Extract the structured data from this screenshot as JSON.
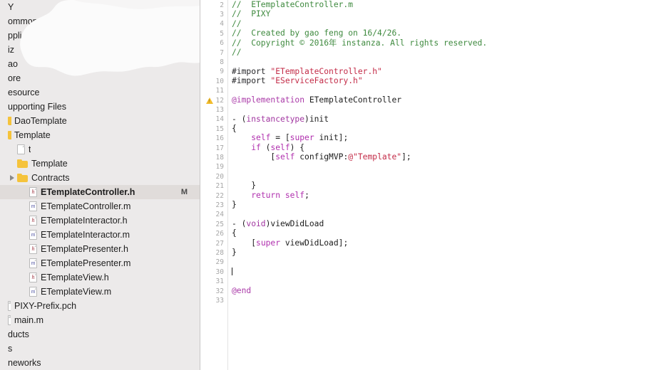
{
  "window": {
    "app": "Xcode",
    "accent": "#f5c33b",
    "selection_bg": "#e0dcda",
    "sidebar_bg": "#eceaea",
    "editor_bg": "#ffffff"
  },
  "sidebar": {
    "name": "project-navigator",
    "scrolled_horizontally": true,
    "items": [
      {
        "label": "Y",
        "depth": 0,
        "icon": "none",
        "tri": "none",
        "badge": "",
        "selected": false
      },
      {
        "label": "ommon",
        "depth": 0,
        "icon": "none",
        "tri": "none",
        "badge": "",
        "selected": false
      },
      {
        "label": "pplication",
        "depth": 0,
        "icon": "none",
        "tri": "none",
        "badge": "",
        "selected": false
      },
      {
        "label": "iz",
        "depth": 0,
        "icon": "none",
        "tri": "none",
        "badge": "",
        "selected": false
      },
      {
        "label": "ao",
        "depth": 0,
        "icon": "none",
        "tri": "none",
        "badge": "",
        "selected": false
      },
      {
        "label": "ore",
        "depth": 0,
        "icon": "none",
        "tri": "none",
        "badge": "",
        "selected": false
      },
      {
        "label": "esource",
        "depth": 0,
        "icon": "none",
        "tri": "none",
        "badge": "",
        "selected": false
      },
      {
        "label": "upporting Files",
        "depth": 0,
        "icon": "none",
        "tri": "none",
        "badge": "",
        "selected": false
      },
      {
        "label": "DaoTemplate",
        "depth": 0,
        "icon": "folder-clip",
        "tri": "none",
        "badge": "",
        "selected": false
      },
      {
        "label": "Template",
        "depth": 0,
        "icon": "folder-clip",
        "tri": "none",
        "badge": "",
        "selected": false
      },
      {
        "label": "t",
        "depth": 1,
        "icon": "file-blank",
        "tri": "none",
        "badge": "",
        "selected": false
      },
      {
        "label": "Template",
        "depth": 1,
        "icon": "folder",
        "tri": "none",
        "badge": "",
        "selected": false
      },
      {
        "label": "Contracts",
        "depth": 1,
        "icon": "folder",
        "tri": "closed",
        "badge": "",
        "selected": false
      },
      {
        "label": "ETemplateController.h",
        "depth": 2,
        "icon": "file-h",
        "tri": "none",
        "badge": "M",
        "selected": true
      },
      {
        "label": "ETemplateController.m",
        "depth": 2,
        "icon": "file-m",
        "tri": "none",
        "badge": "",
        "selected": false
      },
      {
        "label": "ETemplateInteractor.h",
        "depth": 2,
        "icon": "file-h",
        "tri": "none",
        "badge": "",
        "selected": false
      },
      {
        "label": "ETemplateInteractor.m",
        "depth": 2,
        "icon": "file-m",
        "tri": "none",
        "badge": "",
        "selected": false
      },
      {
        "label": "ETemplatePresenter.h",
        "depth": 2,
        "icon": "file-h",
        "tri": "none",
        "badge": "",
        "selected": false
      },
      {
        "label": "ETemplatePresenter.m",
        "depth": 2,
        "icon": "file-m",
        "tri": "none",
        "badge": "",
        "selected": false
      },
      {
        "label": "ETemplateView.h",
        "depth": 2,
        "icon": "file-h",
        "tri": "none",
        "badge": "",
        "selected": false
      },
      {
        "label": "ETemplateView.m",
        "depth": 2,
        "icon": "file-m",
        "tri": "none",
        "badge": "",
        "selected": false
      },
      {
        "label": "PIXY-Prefix.pch",
        "depth": 0,
        "icon": "file-edge",
        "tri": "none",
        "badge": "",
        "selected": false
      },
      {
        "label": "main.m",
        "depth": 0,
        "icon": "file-edge",
        "tri": "none",
        "badge": "",
        "selected": false
      },
      {
        "label": "ducts",
        "depth": 0,
        "icon": "none",
        "tri": "none",
        "badge": "",
        "selected": false
      },
      {
        "label": "s",
        "depth": 0,
        "icon": "none",
        "tri": "none",
        "badge": "",
        "selected": false
      },
      {
        "label": "neworks",
        "depth": 0,
        "icon": "none",
        "tri": "none",
        "badge": "",
        "selected": false
      }
    ]
  },
  "editor": {
    "name": "source-editor",
    "language": "objective-c",
    "first_line": 2,
    "last_line": 33,
    "warning_line": 12,
    "caret_line": 30,
    "lines": [
      {
        "n": 2,
        "tokens": [
          {
            "t": "//  ETemplateController.m",
            "c": "cmt"
          }
        ]
      },
      {
        "n": 3,
        "tokens": [
          {
            "t": "//  PIXY",
            "c": "cmt"
          }
        ]
      },
      {
        "n": 4,
        "tokens": [
          {
            "t": "//",
            "c": "cmt"
          }
        ]
      },
      {
        "n": 5,
        "tokens": [
          {
            "t": "//  Created by gao feng on 16/4/26.",
            "c": "cmt"
          }
        ]
      },
      {
        "n": 6,
        "tokens": [
          {
            "t": "//  Copyright © 2016年 instanza. All rights reserved.",
            "c": "cmt"
          }
        ]
      },
      {
        "n": 7,
        "tokens": [
          {
            "t": "//",
            "c": "cmt"
          }
        ]
      },
      {
        "n": 8,
        "tokens": []
      },
      {
        "n": 9,
        "tokens": [
          {
            "t": "#import ",
            "c": "pp"
          },
          {
            "t": "\"ETemplateController.h\"",
            "c": "str"
          }
        ]
      },
      {
        "n": 10,
        "tokens": [
          {
            "t": "#import ",
            "c": "pp"
          },
          {
            "t": "\"EServiceFactory.h\"",
            "c": "str"
          }
        ]
      },
      {
        "n": 11,
        "tokens": []
      },
      {
        "n": 12,
        "tokens": [
          {
            "t": "@implementation",
            "c": "kw"
          },
          {
            "t": " ETemplateController",
            "c": "pln"
          }
        ]
      },
      {
        "n": 13,
        "tokens": []
      },
      {
        "n": 14,
        "tokens": [
          {
            "t": "- (",
            "c": "pln"
          },
          {
            "t": "instancetype",
            "c": "typ"
          },
          {
            "t": ")init",
            "c": "pln"
          }
        ]
      },
      {
        "n": 15,
        "tokens": [
          {
            "t": "{",
            "c": "pln"
          }
        ]
      },
      {
        "n": 16,
        "tokens": [
          {
            "t": "    ",
            "c": "pln"
          },
          {
            "t": "self",
            "c": "kw2"
          },
          {
            "t": " = [",
            "c": "pln"
          },
          {
            "t": "super",
            "c": "kw2"
          },
          {
            "t": " init];",
            "c": "pln"
          }
        ]
      },
      {
        "n": 17,
        "tokens": [
          {
            "t": "    ",
            "c": "pln"
          },
          {
            "t": "if",
            "c": "kw2"
          },
          {
            "t": " (",
            "c": "pln"
          },
          {
            "t": "self",
            "c": "kw2"
          },
          {
            "t": ") {",
            "c": "pln"
          }
        ]
      },
      {
        "n": 18,
        "tokens": [
          {
            "t": "        [",
            "c": "pln"
          },
          {
            "t": "self",
            "c": "kw2"
          },
          {
            "t": " configMVP:",
            "c": "pln"
          },
          {
            "t": "@\"Template\"",
            "c": "str"
          },
          {
            "t": "];",
            "c": "pln"
          }
        ]
      },
      {
        "n": 19,
        "tokens": []
      },
      {
        "n": 20,
        "tokens": []
      },
      {
        "n": 21,
        "tokens": [
          {
            "t": "    }",
            "c": "pln"
          }
        ]
      },
      {
        "n": 22,
        "tokens": [
          {
            "t": "    ",
            "c": "pln"
          },
          {
            "t": "return",
            "c": "kw2"
          },
          {
            "t": " ",
            "c": "pln"
          },
          {
            "t": "self",
            "c": "kw2"
          },
          {
            "t": ";",
            "c": "pln"
          }
        ]
      },
      {
        "n": 23,
        "tokens": [
          {
            "t": "}",
            "c": "pln"
          }
        ]
      },
      {
        "n": 24,
        "tokens": []
      },
      {
        "n": 25,
        "tokens": [
          {
            "t": "- (",
            "c": "pln"
          },
          {
            "t": "void",
            "c": "typ"
          },
          {
            "t": ")viewDidLoad",
            "c": "pln"
          }
        ]
      },
      {
        "n": 26,
        "tokens": [
          {
            "t": "{",
            "c": "pln"
          }
        ]
      },
      {
        "n": 27,
        "tokens": [
          {
            "t": "    [",
            "c": "pln"
          },
          {
            "t": "super",
            "c": "kw2"
          },
          {
            "t": " viewDidLoad];",
            "c": "pln"
          }
        ]
      },
      {
        "n": 28,
        "tokens": [
          {
            "t": "}",
            "c": "pln"
          }
        ]
      },
      {
        "n": 29,
        "tokens": []
      },
      {
        "n": 30,
        "tokens": [],
        "caret": true
      },
      {
        "n": 31,
        "tokens": []
      },
      {
        "n": 32,
        "tokens": [
          {
            "t": "@end",
            "c": "kw"
          }
        ]
      },
      {
        "n": 33,
        "tokens": []
      }
    ]
  }
}
